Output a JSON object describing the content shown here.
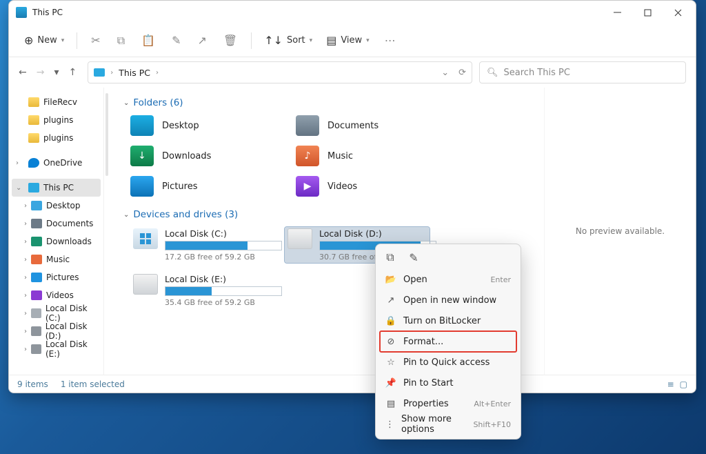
{
  "window": {
    "title": "This PC"
  },
  "toolbar": {
    "new": "New",
    "sort": "Sort",
    "view": "View"
  },
  "address": {
    "crumb": "This PC"
  },
  "search": {
    "placeholder": "Search This PC"
  },
  "sidebar": {
    "fileRecv": "FileRecv",
    "plugins1": "plugins",
    "plugins2": "plugins",
    "onedrive": "OneDrive",
    "thispc": "This PC",
    "desktop": "Desktop",
    "documents": "Documents",
    "downloads": "Downloads",
    "music": "Music",
    "pictures": "Pictures",
    "videos": "Videos",
    "ldc": "Local Disk (C:)",
    "ldd": "Local Disk (D:)",
    "lde": "Local Disk (E:)"
  },
  "sections": {
    "folders": "Folders (6)",
    "drives": "Devices and drives (3)"
  },
  "folders": {
    "desktop": "Desktop",
    "documents": "Documents",
    "downloads": "Downloads",
    "music": "Music",
    "pictures": "Pictures",
    "videos": "Videos"
  },
  "drives": {
    "c": {
      "name": "Local Disk (C:)",
      "free": "17.2 GB free of 59.2 GB",
      "pct": 71
    },
    "d": {
      "name": "Local Disk (D:)",
      "free": "30.7 GB free of 232 GB",
      "pct": 87
    },
    "e": {
      "name": "Local Disk (E:)",
      "free": "35.4 GB free of 59.2 GB",
      "pct": 40
    }
  },
  "preview": {
    "none": "No preview available."
  },
  "status": {
    "items": "9 items",
    "selected": "1 item selected"
  },
  "ctx": {
    "open": "Open",
    "open_sc": "Enter",
    "open_new": "Open in new window",
    "bitlocker": "Turn on BitLocker",
    "format": "Format...",
    "pin_qa": "Pin to Quick access",
    "pin_start": "Pin to Start",
    "properties": "Properties",
    "props_sc": "Alt+Enter",
    "more": "Show more options",
    "more_sc": "Shift+F10"
  }
}
